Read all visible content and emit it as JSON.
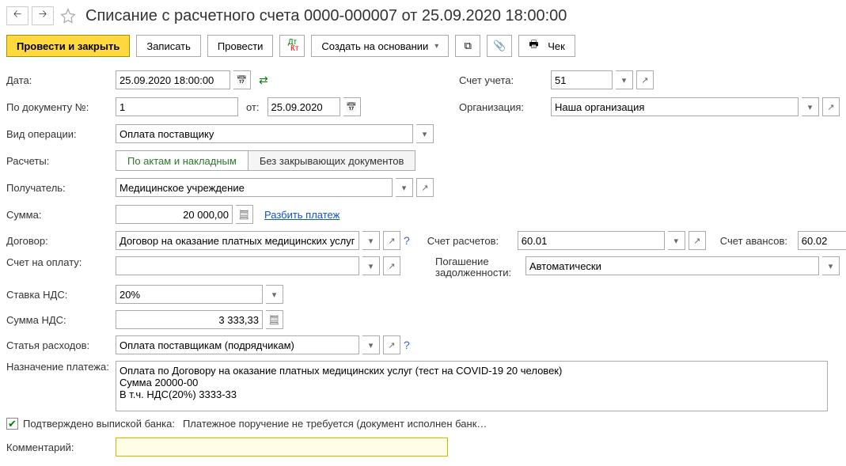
{
  "header": {
    "title": "Списание с расчетного счета 0000-000007 от 25.09.2020 18:00:00"
  },
  "toolbar": {
    "post_close": "Провести и закрыть",
    "save": "Записать",
    "post": "Провести",
    "create_based": "Создать на основании",
    "receipt": "Чек"
  },
  "left": {
    "date_label": "Дата:",
    "date_value": "25.09.2020 18:00:00",
    "doc_num_label": "По документу №:",
    "doc_num_value": "1",
    "doc_num_from": "от:",
    "doc_date_value": "25.09.2020",
    "optype_label": "Вид операции:",
    "optype_value": "Оплата поставщику",
    "calc_label": "Расчеты:",
    "calc_opt1": "По актам и накладным",
    "calc_opt2": "Без закрывающих документов",
    "recipient_label": "Получатель:",
    "recipient_value": "Медицинское учреждение",
    "sum_label": "Сумма:",
    "sum_value": "20 000,00",
    "split_link": "Разбить платеж",
    "contract_label": "Договор:",
    "contract_value": "Договор на оказание платных медицинских услуг",
    "invoice_label": "Счет на оплату:",
    "invoice_value": "",
    "vat_rate_label": "Ставка НДС:",
    "vat_rate_value": "20%",
    "vat_sum_label": "Сумма НДС:",
    "vat_sum_value": "3 333,33",
    "expense_label": "Статья расходов:",
    "expense_value": "Оплата поставщикам (подрядчикам)",
    "purpose_label": "Назначение платежа:",
    "purpose_value": "Оплата по Договору на оказание платных медицинских услуг (тест на COVID-19 20 человек)\nСумма 20000-00\nВ т.ч. НДС(20%) 3333-33"
  },
  "right": {
    "account_label": "Счет учета:",
    "account_value": "51",
    "org_label": "Организация:",
    "org_value": "Наша организация",
    "calc_acc_label": "Счет расчетов:",
    "calc_acc_value": "60.01",
    "advance_acc_label": "Счет авансов:",
    "advance_acc_value": "60.02",
    "debt_label": "Погашение задолженности:",
    "debt_value": "Автоматически"
  },
  "footer": {
    "confirmed_label": "Подтверждено выпиской банка:",
    "confirmed_text": "Платежное поручение не требуется (документ исполнен банк…",
    "comment_label": "Комментарий:",
    "comment_value": ""
  }
}
